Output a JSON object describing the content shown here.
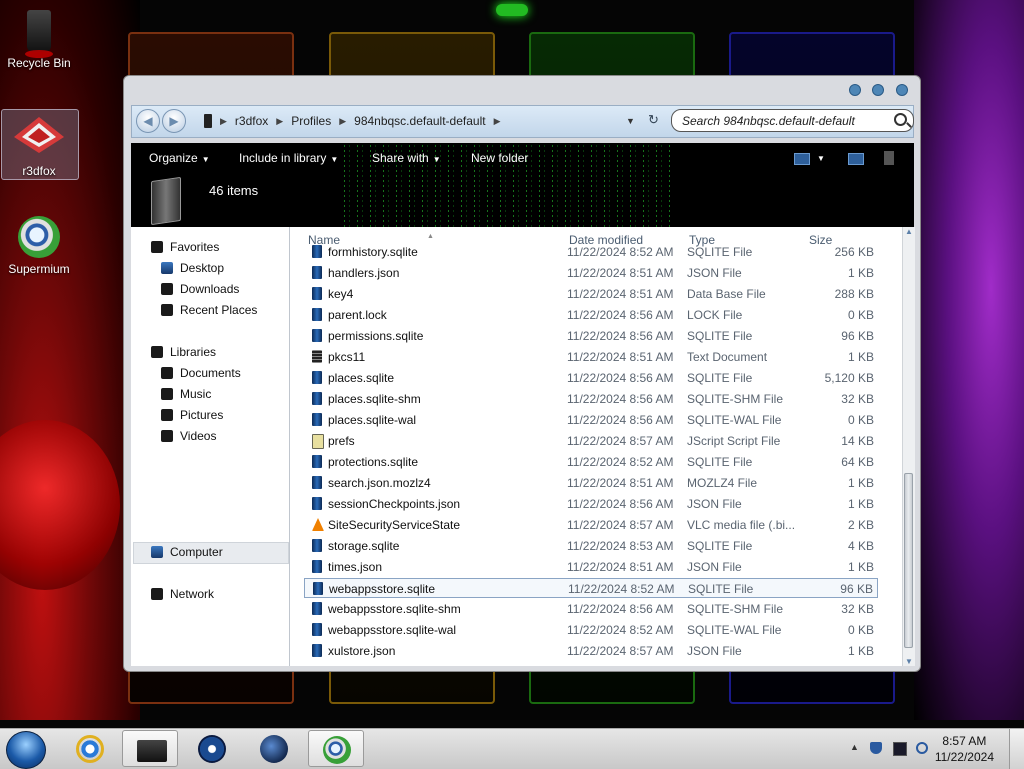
{
  "desktop": {
    "icons": [
      {
        "label": "Recycle Bin"
      },
      {
        "label": "r3dfox"
      },
      {
        "label": "Supermium"
      }
    ]
  },
  "window": {
    "breadcrumbs": [
      "r3dfox",
      "Profiles",
      "984nbqsc.default-default"
    ],
    "search_placeholder": "Search 984nbqsc.default-default",
    "toolbar": {
      "organize": "Organize",
      "include_in_library": "Include in library",
      "share_with": "Share with",
      "new_folder": "New folder"
    },
    "details": {
      "item_count": "46 items"
    },
    "nav": {
      "favorites": "Favorites",
      "desktop": "Desktop",
      "downloads": "Downloads",
      "recent_places": "Recent Places",
      "libraries": "Libraries",
      "documents": "Documents",
      "music": "Music",
      "pictures": "Pictures",
      "videos": "Videos",
      "computer": "Computer",
      "network": "Network"
    },
    "columns": {
      "name": "Name",
      "date": "Date modified",
      "type": "Type",
      "size": "Size"
    },
    "files": [
      {
        "name": "formhistory.sqlite",
        "date": "11/22/2024 8:52 AM",
        "type": "SQLITE File",
        "size": "256 KB",
        "icon": "sqlite-file-icon"
      },
      {
        "name": "handlers.json",
        "date": "11/22/2024 8:51 AM",
        "type": "JSON File",
        "size": "1 KB",
        "icon": "json-file-icon"
      },
      {
        "name": "key4",
        "date": "11/22/2024 8:51 AM",
        "type": "Data Base File",
        "size": "288 KB",
        "icon": "database-file-icon"
      },
      {
        "name": "parent.lock",
        "date": "11/22/2024 8:56 AM",
        "type": "LOCK File",
        "size": "0 KB",
        "icon": "lock-file-icon"
      },
      {
        "name": "permissions.sqlite",
        "date": "11/22/2024 8:56 AM",
        "type": "SQLITE File",
        "size": "96 KB",
        "icon": "sqlite-file-icon"
      },
      {
        "name": "pkcs11",
        "date": "11/22/2024 8:51 AM",
        "type": "Text Document",
        "size": "1 KB",
        "icon": "text-file-icon"
      },
      {
        "name": "places.sqlite",
        "date": "11/22/2024 8:56 AM",
        "type": "SQLITE File",
        "size": "5,120 KB",
        "icon": "sqlite-file-icon"
      },
      {
        "name": "places.sqlite-shm",
        "date": "11/22/2024 8:56 AM",
        "type": "SQLITE-SHM File",
        "size": "32 KB",
        "icon": "sqlite-shm-file-icon"
      },
      {
        "name": "places.sqlite-wal",
        "date": "11/22/2024 8:56 AM",
        "type": "SQLITE-WAL File",
        "size": "0 KB",
        "icon": "sqlite-wal-file-icon"
      },
      {
        "name": "prefs",
        "date": "11/22/2024 8:57 AM",
        "type": "JScript Script File",
        "size": "14 KB",
        "icon": "jscript-file-icon"
      },
      {
        "name": "protections.sqlite",
        "date": "11/22/2024 8:52 AM",
        "type": "SQLITE File",
        "size": "64 KB",
        "icon": "sqlite-file-icon"
      },
      {
        "name": "search.json.mozlz4",
        "date": "11/22/2024 8:51 AM",
        "type": "MOZLZ4 File",
        "size": "1 KB",
        "icon": "mozlz4-file-icon"
      },
      {
        "name": "sessionCheckpoints.json",
        "date": "11/22/2024 8:56 AM",
        "type": "JSON File",
        "size": "1 KB",
        "icon": "json-file-icon"
      },
      {
        "name": "SiteSecurityServiceState",
        "date": "11/22/2024 8:57 AM",
        "type": "VLC media file (.bi...",
        "size": "2 KB",
        "icon": "vlc-file-icon"
      },
      {
        "name": "storage.sqlite",
        "date": "11/22/2024 8:53 AM",
        "type": "SQLITE File",
        "size": "4 KB",
        "icon": "sqlite-file-icon"
      },
      {
        "name": "times.json",
        "date": "11/22/2024 8:51 AM",
        "type": "JSON File",
        "size": "1 KB",
        "icon": "json-file-icon"
      },
      {
        "name": "webappsstore.sqlite",
        "date": "11/22/2024 8:52 AM",
        "type": "SQLITE File",
        "size": "96 KB",
        "icon": "sqlite-file-icon",
        "selected": true
      },
      {
        "name": "webappsstore.sqlite-shm",
        "date": "11/22/2024 8:56 AM",
        "type": "SQLITE-SHM File",
        "size": "32 KB",
        "icon": "sqlite-shm-file-icon"
      },
      {
        "name": "webappsstore.sqlite-wal",
        "date": "11/22/2024 8:52 AM",
        "type": "SQLITE-WAL File",
        "size": "0 KB",
        "icon": "sqlite-wal-file-icon"
      },
      {
        "name": "xulstore.json",
        "date": "11/22/2024 8:57 AM",
        "type": "JSON File",
        "size": "1 KB",
        "icon": "json-file-icon"
      }
    ]
  },
  "taskbar": {
    "clock_time": "8:57 AM",
    "clock_date": "11/22/2024"
  },
  "colors": {
    "accent": "#4e86b6",
    "selection": "#8aa4c4",
    "matrix_green": "#28d232"
  }
}
